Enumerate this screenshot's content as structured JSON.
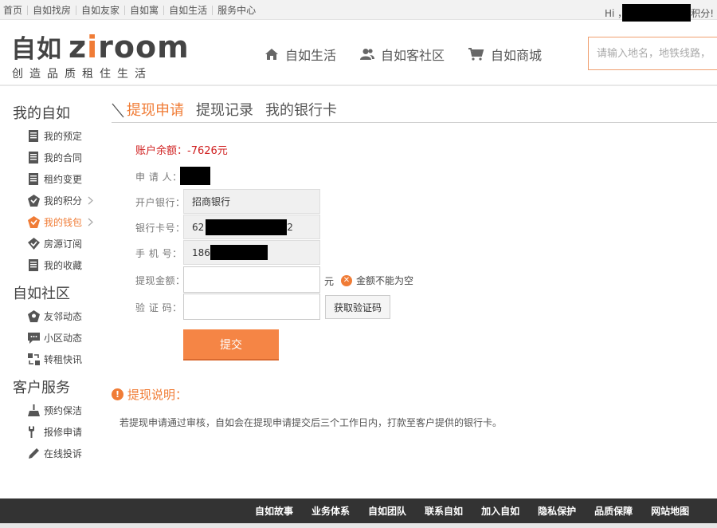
{
  "topbar": {
    "links": [
      "首页",
      "自如找房",
      "自如友家",
      "自如寓",
      "自如生活",
      "服务中心"
    ],
    "greeting_prefix": "Hi ，",
    "greeting_suffix": "积分!"
  },
  "header": {
    "logo_cn": "自如",
    "logo_en_pre": "z",
    "logo_en_i": "i",
    "logo_en_post": "room",
    "logo_slogan": "创造品质租住生活",
    "nav": [
      {
        "label": "自如生活",
        "icon": "home-icon"
      },
      {
        "label": "自如客社区",
        "icon": "users-icon"
      },
      {
        "label": "自如商城",
        "icon": "cart-icon"
      }
    ],
    "search_placeholder": "请输入地名，地铁线路，"
  },
  "sidebar": {
    "groups": [
      {
        "title": "我的自如",
        "items": [
          {
            "label": "我的预定",
            "icon": "document-icon"
          },
          {
            "label": "我的合同",
            "icon": "document-icon"
          },
          {
            "label": "租约变更",
            "icon": "document-icon"
          },
          {
            "label": "我的积分",
            "icon": "points-icon"
          },
          {
            "label": "我的钱包",
            "icon": "wallet-icon",
            "active": true
          },
          {
            "label": "房源订阅",
            "icon": "subscribe-icon"
          },
          {
            "label": "我的收藏",
            "icon": "document-icon"
          }
        ]
      },
      {
        "title": "自如社区",
        "items": [
          {
            "label": "友邻动态",
            "icon": "neighbor-icon"
          },
          {
            "label": "小区动态",
            "icon": "chat-icon"
          },
          {
            "label": "转租快讯",
            "icon": "sublet-icon"
          }
        ]
      },
      {
        "title": "客户服务",
        "items": [
          {
            "label": "预约保洁",
            "icon": "broom-icon"
          },
          {
            "label": "报修申请",
            "icon": "wrench-icon"
          },
          {
            "label": "在线投诉",
            "icon": "pen-icon"
          }
        ]
      }
    ]
  },
  "tabs": [
    "提现申请",
    "提现记录",
    "我的银行卡"
  ],
  "form": {
    "balance": "账户余额：-7626元",
    "applicant_label": "申 请 人：",
    "bank_label": "开户银行：",
    "bank_value": "招商银行",
    "card_label": "银行卡号：",
    "card_prefix": "62",
    "card_suffix": "2",
    "phone_label": "手 机 号：",
    "phone_prefix": "186",
    "amount_label": "提现金额：",
    "amount_value": "",
    "unit": "元",
    "amount_error": "金额不能为空",
    "code_label": "验 证 码：",
    "code_value": "",
    "code_button": "获取验证码",
    "submit": "提交"
  },
  "notes": {
    "title": "提现说明：",
    "text": "若提现申请通过审核，自如会在提现申请提交后三个工作日内，打款至客户提供的银行卡。"
  },
  "footer": {
    "links": [
      "自如故事",
      "业务体系",
      "自如团队",
      "联系自如",
      "加入自如",
      "隐私保护",
      "品质保障",
      "网站地图"
    ]
  },
  "colors": {
    "accent": "#f07c36",
    "balance_red": "#d02020",
    "footer_bg": "#333333"
  }
}
